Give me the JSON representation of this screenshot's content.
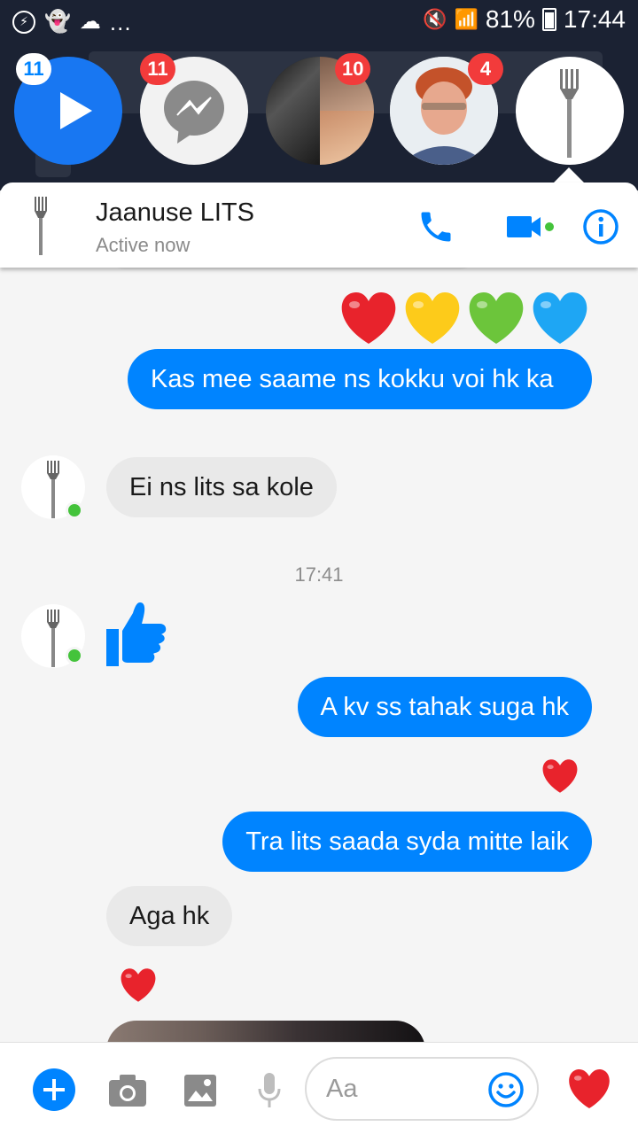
{
  "status_bar": {
    "battery": "81%",
    "time": "17:44",
    "dots": "..."
  },
  "chat_heads": [
    {
      "badge": "11"
    },
    {
      "badge": "11"
    },
    {
      "badge": "10"
    },
    {
      "badge": "4"
    }
  ],
  "header": {
    "name": "Jaanuse LITS",
    "status": "Active now"
  },
  "messages": {
    "out_1": "Kas mee saame ns kokku voi hk ka",
    "in_1": "Ei ns lits sa kole",
    "timestamp": "17:41",
    "out_2": "A kv ss tahak suga hk",
    "out_3": "Tra lits saada syda mitte laik",
    "in_2": "Aga hk"
  },
  "composer": {
    "placeholder": "Aa"
  },
  "colors": {
    "messenger_blue": "#0084ff",
    "online_green": "#44c33b",
    "badge_red": "#f23b3b",
    "heart_red": "#e8232c"
  }
}
